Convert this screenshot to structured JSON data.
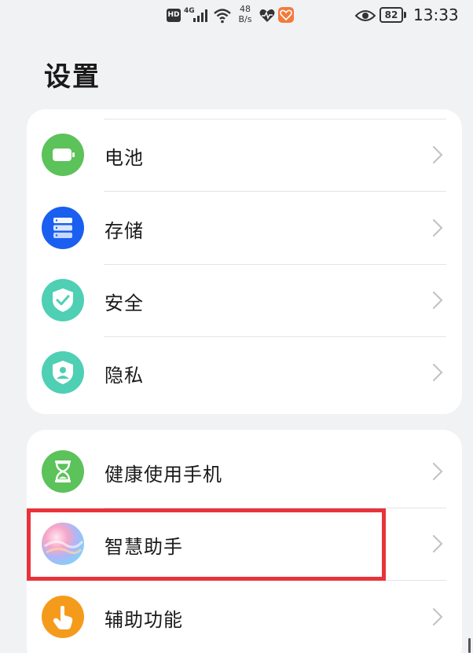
{
  "status_bar": {
    "hd": "HD",
    "network": "4G",
    "speed_value": "48",
    "speed_unit": "B/s",
    "battery": "82",
    "time": "13:33"
  },
  "page": {
    "title": "设置"
  },
  "groups": [
    {
      "items": [
        {
          "label": "电池",
          "icon": "battery-icon",
          "color": "#5cc25a"
        },
        {
          "label": "存储",
          "icon": "storage-icon",
          "color": "#1a5ff0"
        },
        {
          "label": "安全",
          "icon": "shield-check-icon",
          "color": "#4fcfb4"
        },
        {
          "label": "隐私",
          "icon": "privacy-shield-icon",
          "color": "#4fcfb4"
        }
      ]
    },
    {
      "items": [
        {
          "label": "健康使用手机",
          "icon": "hourglass-icon",
          "color": "#5cc25a"
        },
        {
          "label": "智慧助手",
          "icon": "assistant-orb-icon",
          "color": "#c9a8f5"
        },
        {
          "label": "辅助功能",
          "icon": "hand-touch-icon",
          "color": "#f59b1c"
        }
      ]
    }
  ],
  "colors": {
    "background": "#f1f2f4",
    "card": "#ffffff",
    "highlight": "#e8333b"
  }
}
